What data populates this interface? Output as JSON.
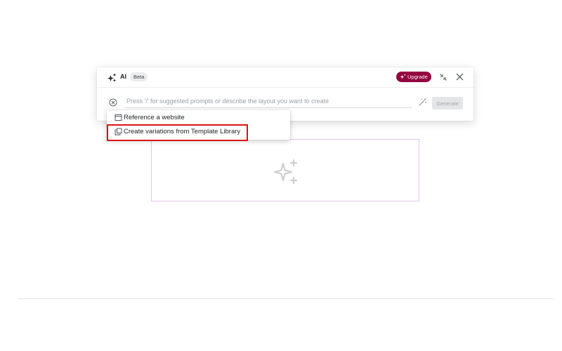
{
  "panel": {
    "title": "AI",
    "badge": "Beta",
    "upgrade_label": "Upgrade",
    "icons": {
      "ai": "sparkle-icon",
      "upgrade": "crown-icon",
      "minimize": "minimize-icon",
      "close": "close-icon"
    }
  },
  "prompt": {
    "placeholder": "Press '/' for suggested prompts or describe the layout you want to create",
    "value": "",
    "generate_label": "Generate",
    "icons": {
      "clear": "circle-close-icon",
      "enhance": "magic-wand-icon"
    }
  },
  "menu": {
    "items": [
      {
        "label": "Reference a website",
        "icon": "browser-window-icon"
      },
      {
        "label": "Create variations from Template Library",
        "icon": "copy-template-icon",
        "highlighted": true
      }
    ]
  },
  "canvas": {
    "placeholder_icon": "sparkle-icon"
  },
  "colors": {
    "upgrade": "#93003f",
    "highlight": "#e01010",
    "frame_border": "#e3c6ea"
  }
}
